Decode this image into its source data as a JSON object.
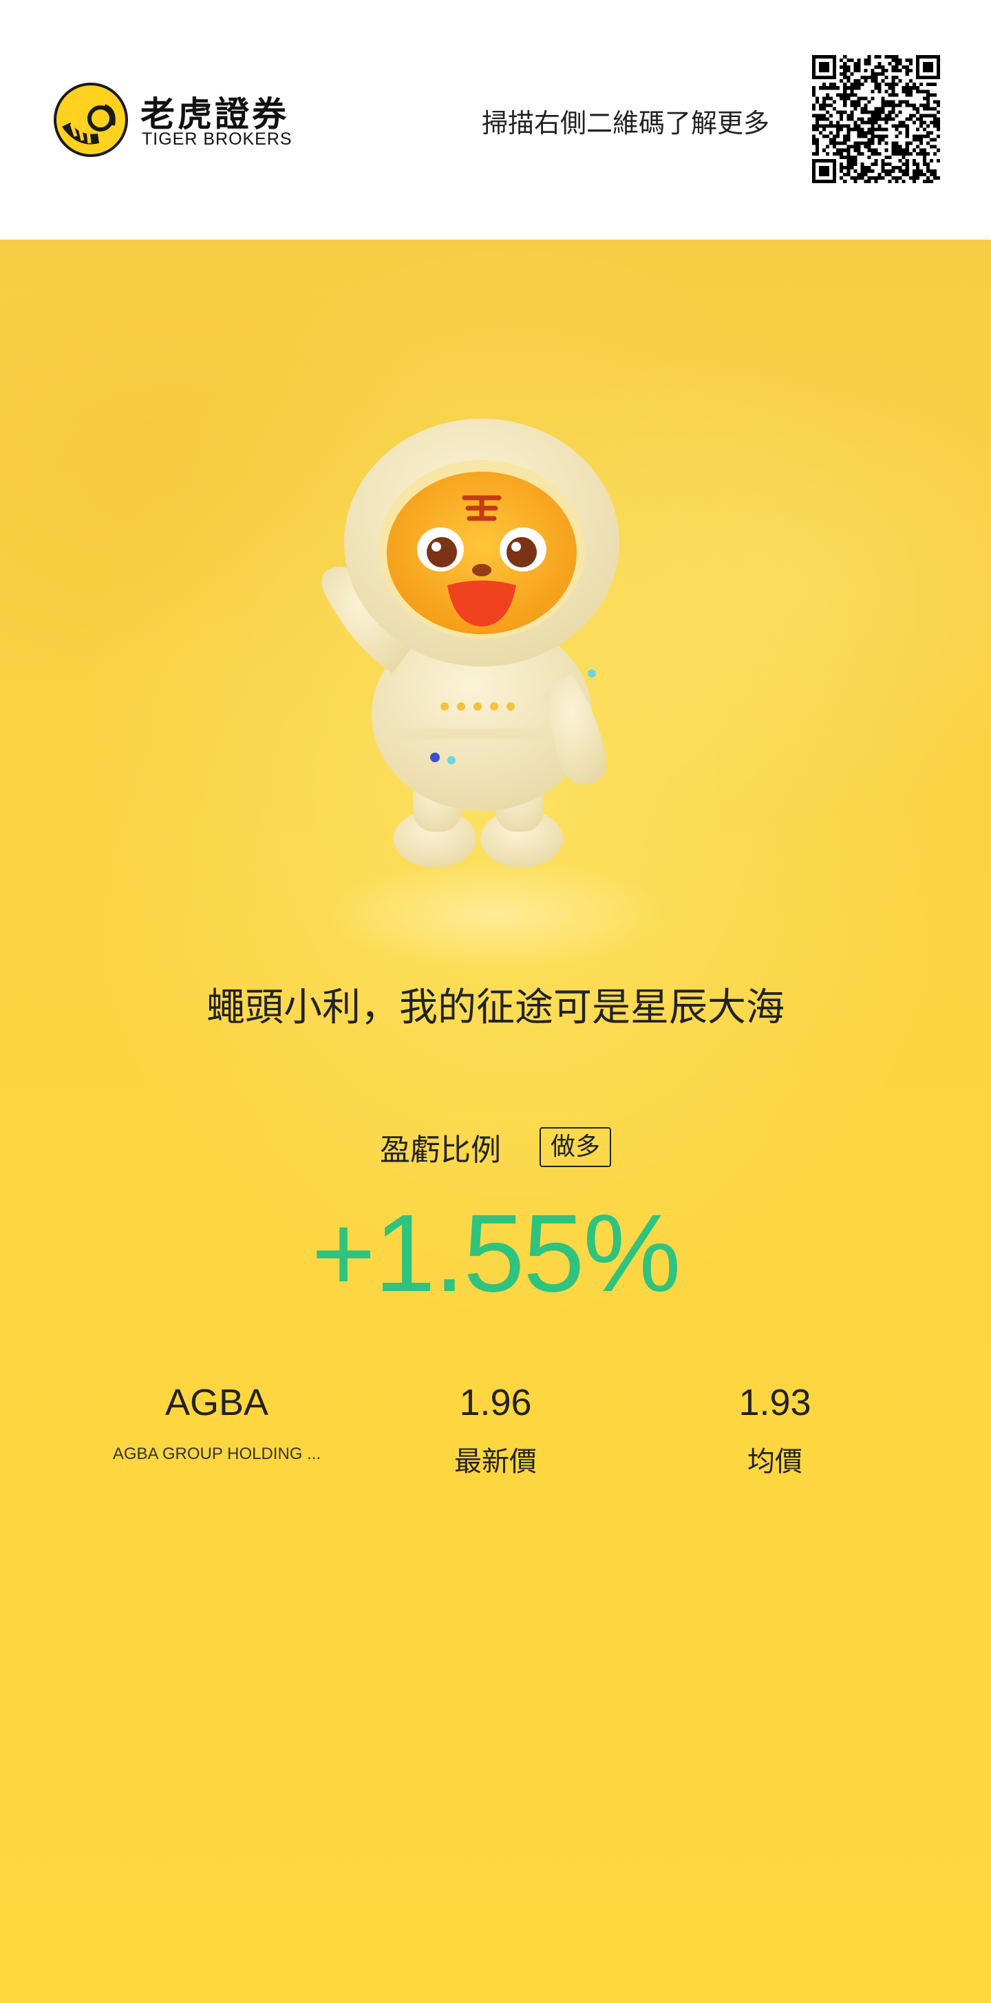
{
  "brand": {
    "name_cn": "老虎證券",
    "name_en": "TIGER BROKERS",
    "color": "#ffd21f"
  },
  "header": {
    "scan_text": "掃描右側二維碼了解更多"
  },
  "poster": {
    "slogan": "蠅頭小利，我的征途可是星辰大海",
    "ratio_label": "盈虧比例",
    "direction_badge": "做多",
    "percent_change": "+1.55%",
    "gain_color": "#2ec37e",
    "bg_color": "#fbd443"
  },
  "stock": {
    "symbol": "AGBA",
    "name": "AGBA GROUP HOLDING ...",
    "last_price": "1.96",
    "last_price_label": "最新價",
    "avg_price": "1.93",
    "avg_price_label": "均價"
  },
  "icons": {
    "logo": "tiger-logo-icon",
    "qr": "qr-code-icon",
    "mascot": "tiger-astronaut-mascot"
  }
}
